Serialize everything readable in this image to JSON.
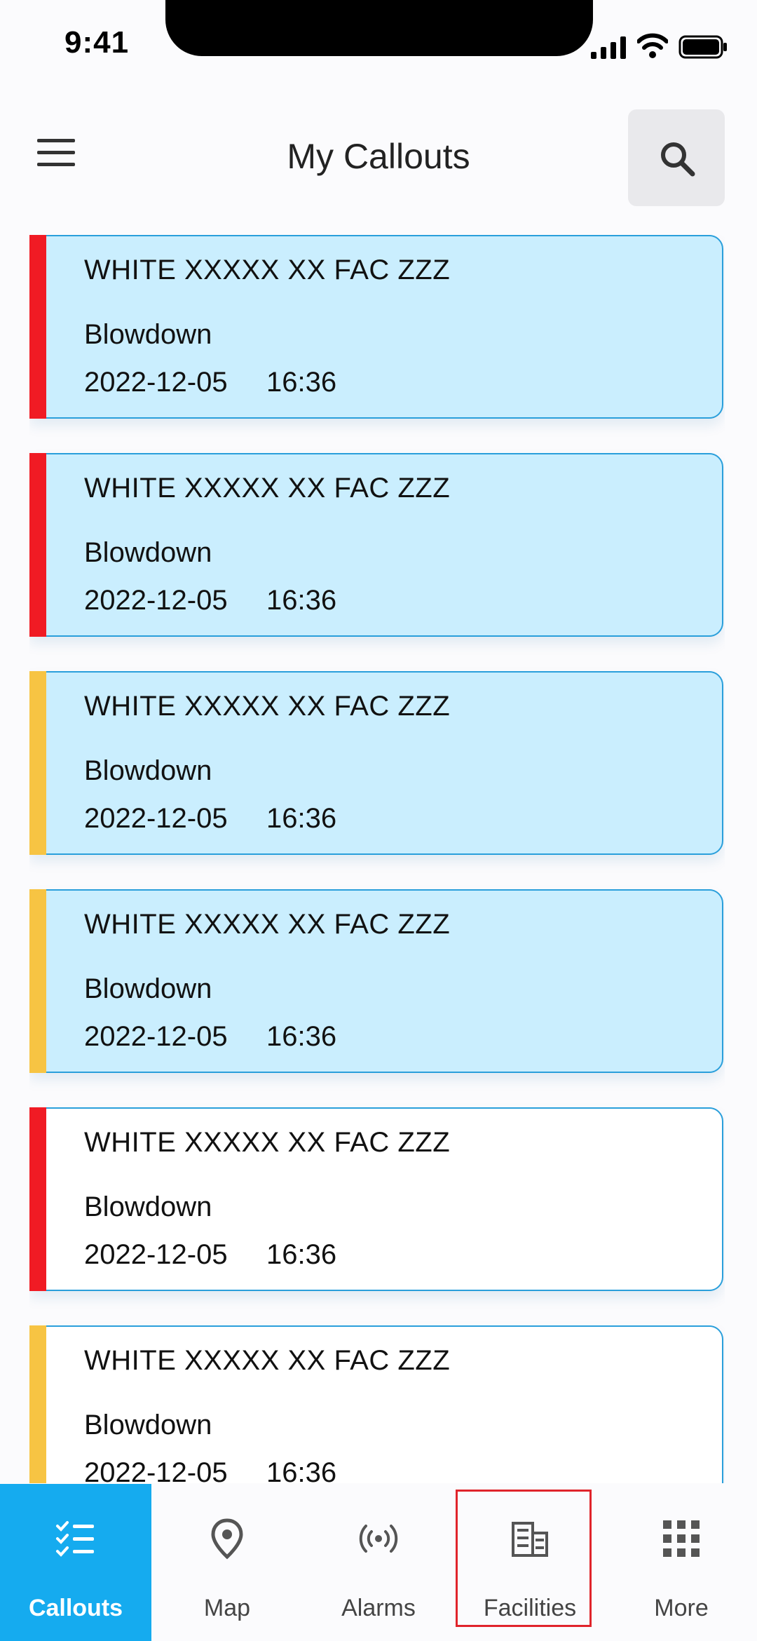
{
  "status_bar": {
    "time": "9:41"
  },
  "header": {
    "title": "My Callouts"
  },
  "colors": {
    "accent": "#15ABEF",
    "card_highlight": "#CAEEFE",
    "priority_red": "#F01B24",
    "priority_yellow": "#F7C443",
    "card_border": "#2A9FDB"
  },
  "callouts": [
    {
      "title": "WHITE XXXXX XX FAC ZZZ",
      "type": "Blowdown",
      "date": "2022-12-05",
      "time": "16:36",
      "priority": "red",
      "highlighted": true
    },
    {
      "title": "WHITE XXXXX XX FAC ZZZ",
      "type": "Blowdown",
      "date": "2022-12-05",
      "time": "16:36",
      "priority": "red",
      "highlighted": true
    },
    {
      "title": "WHITE XXXXX XX FAC ZZZ",
      "type": "Blowdown",
      "date": "2022-12-05",
      "time": "16:36",
      "priority": "yellow",
      "highlighted": true
    },
    {
      "title": "WHITE XXXXX XX FAC ZZZ",
      "type": "Blowdown",
      "date": "2022-12-05",
      "time": "16:36",
      "priority": "yellow",
      "highlighted": true
    },
    {
      "title": "WHITE XXXXX XX FAC ZZZ",
      "type": "Blowdown",
      "date": "2022-12-05",
      "time": "16:36",
      "priority": "red",
      "highlighted": false
    },
    {
      "title": "WHITE XXXXX XX FAC ZZZ",
      "type": "Blowdown",
      "date": "2022-12-05",
      "time": "16:36",
      "priority": "yellow",
      "highlighted": false
    }
  ],
  "nav": {
    "items": [
      {
        "label": "Callouts",
        "icon": "checklist-icon",
        "active": true
      },
      {
        "label": "Map",
        "icon": "map-pin-icon",
        "active": false
      },
      {
        "label": "Alarms",
        "icon": "broadcast-icon",
        "active": false
      },
      {
        "label": "Facilities",
        "icon": "building-icon",
        "active": false
      },
      {
        "label": "More",
        "icon": "grid-icon",
        "active": false
      }
    ]
  }
}
